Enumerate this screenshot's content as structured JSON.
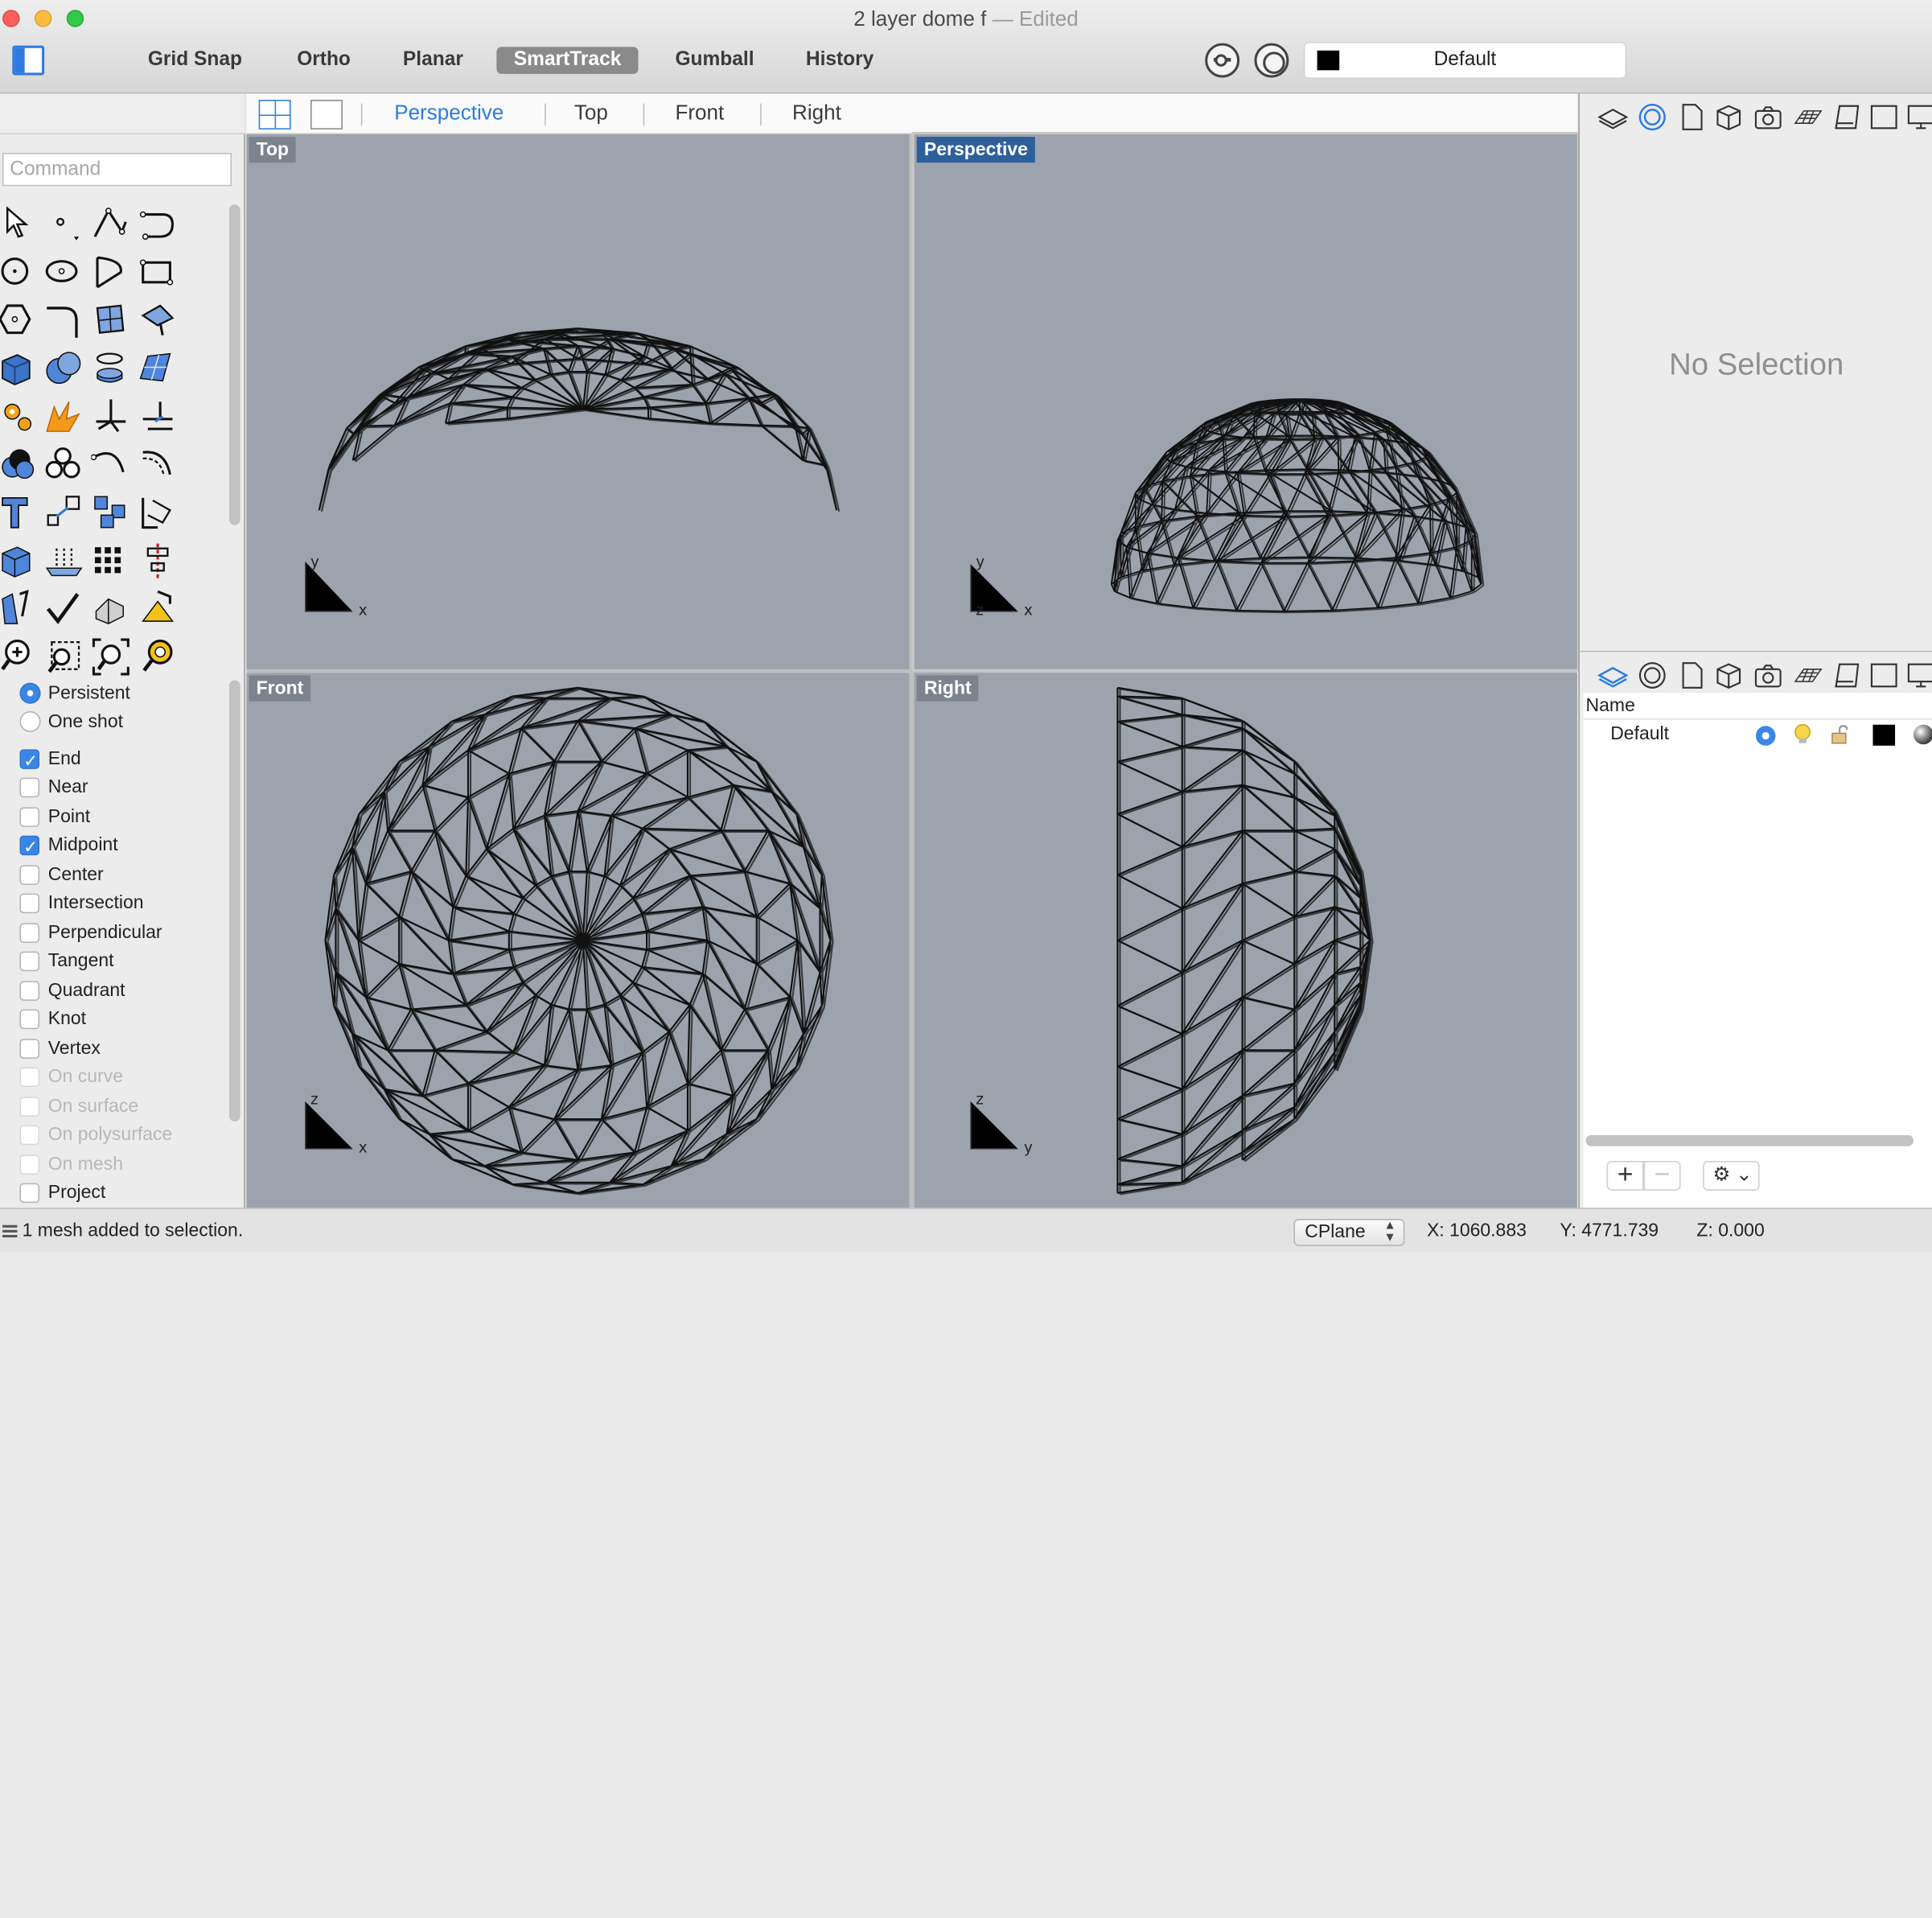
{
  "window": {
    "title": "2 layer dome f",
    "separator": "—",
    "status": "Edited"
  },
  "toolbar": {
    "buttons": [
      "Grid Snap",
      "Ortho",
      "Planar",
      "SmartTrack",
      "Gumball",
      "History"
    ],
    "active_button": "SmartTrack",
    "current_layer": "Default",
    "current_layer_color": "#000000"
  },
  "command": {
    "placeholder": "Command"
  },
  "osnap": {
    "mode_options": [
      {
        "label": "Persistent",
        "selected": true
      },
      {
        "label": "One shot",
        "selected": false
      }
    ],
    "items": [
      {
        "label": "End",
        "checked": true,
        "enabled": true
      },
      {
        "label": "Near",
        "checked": false,
        "enabled": true
      },
      {
        "label": "Point",
        "checked": false,
        "enabled": true
      },
      {
        "label": "Midpoint",
        "checked": true,
        "enabled": true
      },
      {
        "label": "Center",
        "checked": false,
        "enabled": true
      },
      {
        "label": "Intersection",
        "checked": false,
        "enabled": true
      },
      {
        "label": "Perpendicular",
        "checked": false,
        "enabled": true
      },
      {
        "label": "Tangent",
        "checked": false,
        "enabled": true
      },
      {
        "label": "Quadrant",
        "checked": false,
        "enabled": true
      },
      {
        "label": "Knot",
        "checked": false,
        "enabled": true
      },
      {
        "label": "Vertex",
        "checked": false,
        "enabled": true
      },
      {
        "label": "On curve",
        "checked": false,
        "enabled": false
      },
      {
        "label": "On surface",
        "checked": false,
        "enabled": false
      },
      {
        "label": "On polysurface",
        "checked": false,
        "enabled": false
      },
      {
        "label": "On mesh",
        "checked": false,
        "enabled": false
      },
      {
        "label": "Project",
        "checked": false,
        "enabled": true
      }
    ]
  },
  "viewport_tabs": {
    "tabs": [
      "Perspective",
      "Top",
      "Front",
      "Right"
    ],
    "active": "Perspective"
  },
  "viewports": {
    "top": {
      "label": "Top",
      "axis_h": "x",
      "axis_v": "y"
    },
    "perspective": {
      "label": "Perspective",
      "axis_h": "x",
      "axis_v": "y",
      "axis_d": "z"
    },
    "front": {
      "label": "Front",
      "axis_h": "x",
      "axis_v": "z"
    },
    "right": {
      "label": "Right",
      "axis_h": "y",
      "axis_v": "z"
    }
  },
  "properties": {
    "empty_text": "No Selection"
  },
  "layers": {
    "column_name": "Name",
    "rows": [
      {
        "name": "Default",
        "current": true,
        "visible": true,
        "locked": false,
        "color": "#000000"
      }
    ]
  },
  "status_bar": {
    "message": "1 mesh added to selection.",
    "cplane": "CPlane",
    "x": "X: 1060.883",
    "y": "Y: 4771.739",
    "z": "Z: 0.000"
  },
  "colors": {
    "accent": "#2b7cde",
    "viewport_bg": "#9ca3ad",
    "active_label_bg": "#2d5f9a",
    "mesh_wire": "#111111"
  }
}
